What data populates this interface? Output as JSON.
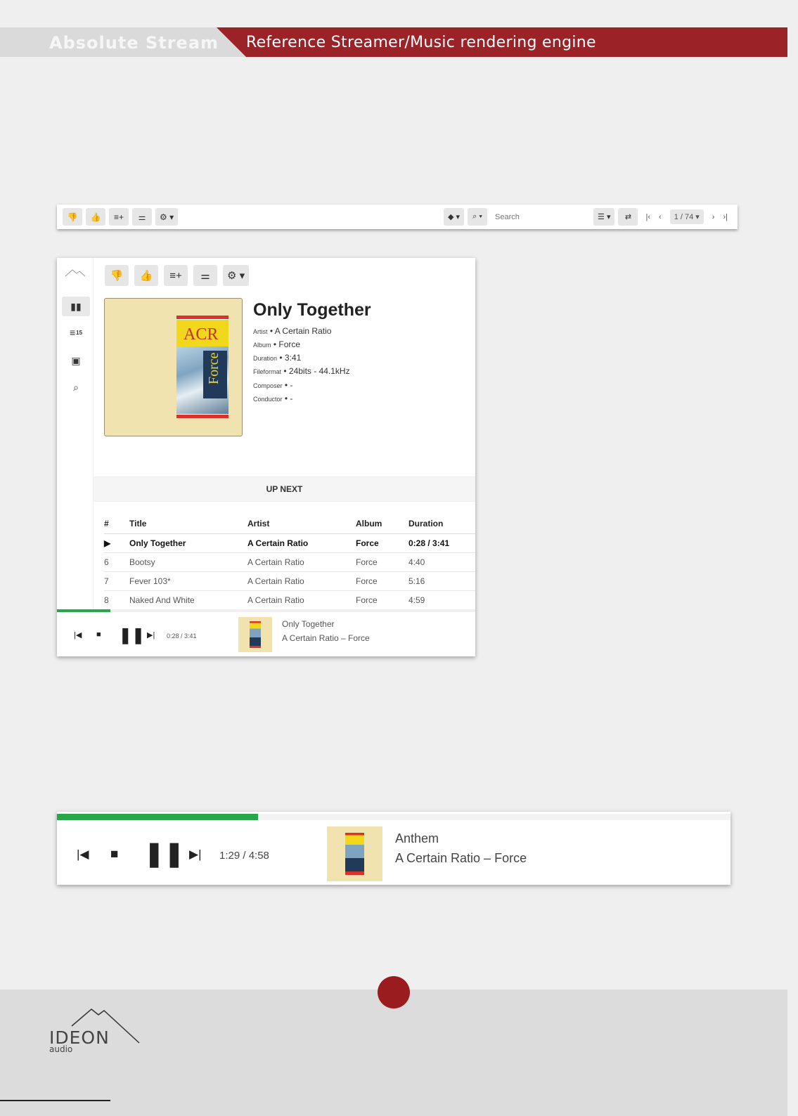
{
  "banner": {
    "brand": "Absolute Stream",
    "subtitle": "Reference Streamer/Music rendering engine"
  },
  "toolbar": {
    "search_placeholder": "Search",
    "page": "1 / 74"
  },
  "now_playing": {
    "title": "Only Together",
    "meta": [
      {
        "key": "Artist",
        "value": "A Certain Ratio"
      },
      {
        "key": "Album",
        "value": "Force"
      },
      {
        "key": "Duration",
        "value": "3:41"
      },
      {
        "key": "Fileformat",
        "value": "24bits - 44.1kHz"
      },
      {
        "key": "Composer",
        "value": "-"
      },
      {
        "key": "Conductor",
        "value": "-"
      }
    ],
    "cover": {
      "band": "ACR",
      "album": "Force"
    }
  },
  "sidebar": {
    "queue_badge": "15"
  },
  "queue": {
    "heading": "UP NEXT",
    "columns": [
      "#",
      "Title",
      "Artist",
      "Album",
      "Duration"
    ],
    "rows": [
      {
        "num": "▶",
        "title": "Only Together",
        "artist": "A Certain Ratio",
        "album": "Force",
        "duration": "0:28 / 3:41",
        "current": true
      },
      {
        "num": "6",
        "title": "Bootsy",
        "artist": "A Certain Ratio",
        "album": "Force",
        "duration": "4:40"
      },
      {
        "num": "7",
        "title": "Fever 103*",
        "artist": "A Certain Ratio",
        "album": "Force",
        "duration": "5:16"
      },
      {
        "num": "8",
        "title": "Naked And White",
        "artist": "A Certain Ratio",
        "album": "Force",
        "duration": "4:59"
      }
    ]
  },
  "mini_player": {
    "time": "0:28 / 3:41",
    "song": "Only Together",
    "sub": "A Certain Ratio – Force",
    "progress_fraction": 0.127
  },
  "big_player": {
    "time": "1:29 / 4:58",
    "song": "Anthem",
    "sub": "A Certain Ratio – Force",
    "progress_fraction": 0.299
  },
  "footer": {
    "brand": "IDEON",
    "brand_sub": "audio"
  },
  "colors": {
    "accent_red": "#9b2226",
    "progress_green": "#2aa64a"
  }
}
